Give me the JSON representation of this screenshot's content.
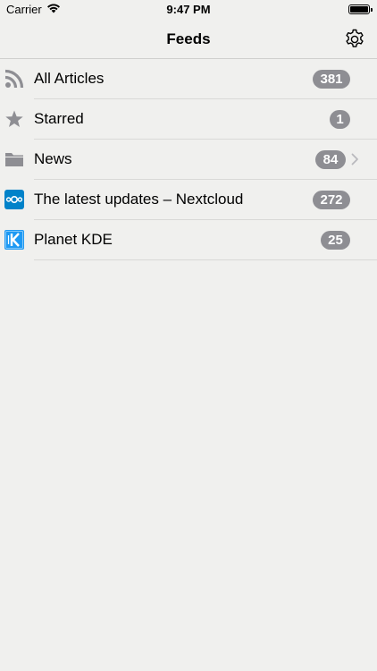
{
  "status_bar": {
    "carrier": "Carrier",
    "time": "9:47 PM",
    "wifi_icon": "wifi-icon",
    "battery_icon": "battery-icon"
  },
  "nav": {
    "title": "Feeds",
    "settings_icon": "gear-icon"
  },
  "colors": {
    "background": "#f0f0ee",
    "badge": "#8e8e93",
    "icon_gray": "#8e8e93",
    "nextcloud_blue": "#0082c9",
    "kde_blue": "#1d99f3"
  },
  "feeds": [
    {
      "label": "All Articles",
      "count": "381",
      "icon": "rss-icon"
    },
    {
      "label": "Starred",
      "count": "1",
      "icon": "star-icon"
    },
    {
      "label": "News",
      "count": "84",
      "icon": "folder-icon",
      "has_chevron": true
    },
    {
      "label": "The latest updates – Nextcloud",
      "count": "272",
      "icon": "nextcloud-icon"
    },
    {
      "label": "Planet KDE",
      "count": "25",
      "icon": "kde-icon"
    }
  ]
}
